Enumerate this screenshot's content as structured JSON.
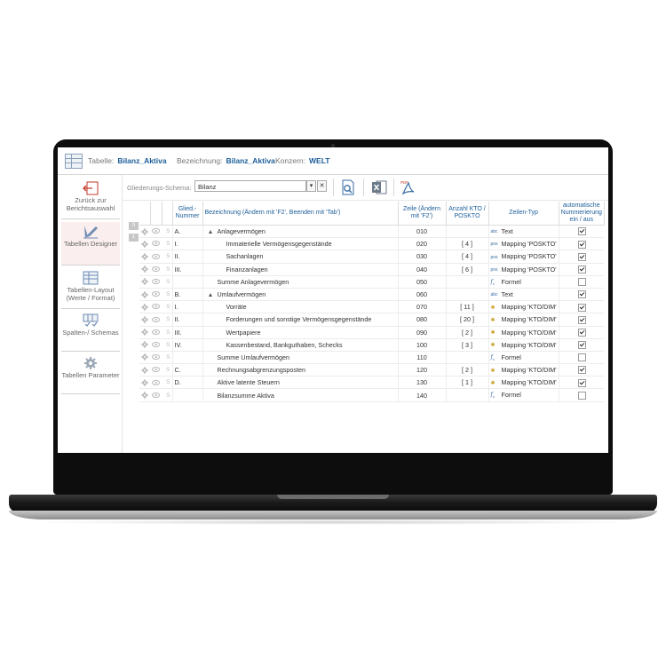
{
  "header": {
    "table_label": "Tabelle:",
    "table_value": "Bilanz_Aktiva",
    "desc_label": "Bezeichnung:",
    "desc_value": "Bilanz_Aktiva",
    "konzern_label": "Konzern:",
    "konzern_value": "WELT"
  },
  "sidebar": {
    "items": [
      {
        "label": "Zurück zur Berichtsauswahl",
        "icon": "back-arrow-icon"
      },
      {
        "label": "Tabellen Designer",
        "icon": "designer-pen-icon"
      },
      {
        "label": "Tabellen-Layout (Werte / Format)",
        "icon": "table-layout-icon"
      },
      {
        "label": "Spalten-/ Schemas",
        "icon": "columns-schema-icon"
      },
      {
        "label": "Tabellen Parameter",
        "icon": "gear-icon"
      }
    ]
  },
  "toolbar": {
    "schema_label": "Gliederungs-Schema:",
    "schema_value": "Bilanz",
    "dropdown_glyph": "▾",
    "clear_glyph": "✕",
    "pdf_label": "PDF"
  },
  "left_tabs": [
    "0",
    "1"
  ],
  "columns": {
    "glied": "Glied.- Nummer",
    "bez": "Bezeichnung  (Ändern mit 'F2', Beenden mit 'Tab')",
    "zeile": "Zeile (Ändern mit 'F2')",
    "anzahl": "Anzahl KTO / POSKTO",
    "typ": "Zeilen-Typ",
    "auto": "automatische Nummerierung ein / aus"
  },
  "rows": [
    {
      "glied": "A.",
      "bez": "Anlagevermögen",
      "indent": 0,
      "expand": true,
      "zeile": "010",
      "anzahl": "",
      "typ": "Text",
      "typ_icon": "text",
      "auto": true
    },
    {
      "glied": "I.",
      "bez": "Immaterielle Vermögensgegenstände",
      "indent": 2,
      "expand": false,
      "zeile": "020",
      "anzahl": "[ 4 ]",
      "typ": "Mapping 'POSKTO'",
      "typ_icon": "pos",
      "auto": true
    },
    {
      "glied": "II.",
      "bez": "Sachanlagen",
      "indent": 2,
      "expand": false,
      "zeile": "030",
      "anzahl": "[ 4 ]",
      "typ": "Mapping 'POSKTO'",
      "typ_icon": "pos",
      "auto": true
    },
    {
      "glied": "III.",
      "bez": "Finanzanlagen",
      "indent": 2,
      "expand": false,
      "zeile": "040",
      "anzahl": "[ 6 ]",
      "typ": "Mapping 'POSKTO'",
      "typ_icon": "pos",
      "auto": true
    },
    {
      "glied": "",
      "bez": "Summe Anlagevermögen",
      "indent": 1,
      "expand": false,
      "zeile": "050",
      "anzahl": "",
      "typ": "Formel",
      "typ_icon": "fx",
      "auto": false
    },
    {
      "glied": "B.",
      "bez": "Umlaufvermögen",
      "indent": 0,
      "expand": true,
      "zeile": "060",
      "anzahl": "",
      "typ": "Text",
      "typ_icon": "text",
      "auto": true
    },
    {
      "glied": "I.",
      "bez": "Vorräte",
      "indent": 2,
      "expand": false,
      "zeile": "070",
      "anzahl": "[ 11 ]",
      "typ": "Mapping 'KTO/DIM'",
      "typ_icon": "map",
      "auto": true
    },
    {
      "glied": "II.",
      "bez": "Forderungen und sonstige Vermögensgegenstände",
      "indent": 2,
      "expand": false,
      "zeile": "080",
      "anzahl": "[ 20 ]",
      "typ": "Mapping 'KTO/DIM'",
      "typ_icon": "map",
      "auto": true
    },
    {
      "glied": "III.",
      "bez": "Wertpapiere",
      "indent": 2,
      "expand": false,
      "zeile": "090",
      "anzahl": "[ 2 ]",
      "typ": "Mapping 'KTO/DIM'",
      "typ_icon": "map",
      "auto": true
    },
    {
      "glied": "IV.",
      "bez": "Kassenbestand, Bankguthaben, Schecks",
      "indent": 2,
      "expand": false,
      "zeile": "100",
      "anzahl": "[ 3 ]",
      "typ": "Mapping 'KTO/DIM'",
      "typ_icon": "map",
      "auto": true
    },
    {
      "glied": "",
      "bez": "Summe Umlaufvermögen",
      "indent": 1,
      "expand": false,
      "zeile": "110",
      "anzahl": "",
      "typ": "Formel",
      "typ_icon": "fx",
      "auto": false
    },
    {
      "glied": "C.",
      "bez": "Rechnungsabgrenzungsposten",
      "indent": 1,
      "expand": false,
      "zeile": "120",
      "anzahl": "[ 2 ]",
      "typ": "Mapping 'KTO/DIM'",
      "typ_icon": "map",
      "auto": true
    },
    {
      "glied": "D.",
      "bez": "Aktive latente Steuern",
      "indent": 1,
      "expand": false,
      "zeile": "130",
      "anzahl": "[ 1 ]",
      "typ": "Mapping 'KTO/DIM'",
      "typ_icon": "map",
      "auto": true
    },
    {
      "glied": "",
      "bez": "Bilanzsumme Aktiva",
      "indent": 1,
      "expand": false,
      "zeile": "140",
      "anzahl": "",
      "typ": "Formel",
      "typ_icon": "fx",
      "auto": false
    }
  ],
  "row_icons": {
    "s_label": "S"
  },
  "colors": {
    "accent": "#1c5d99",
    "active_bg": "#fbeeee",
    "back_arrow": "#c0392b"
  }
}
